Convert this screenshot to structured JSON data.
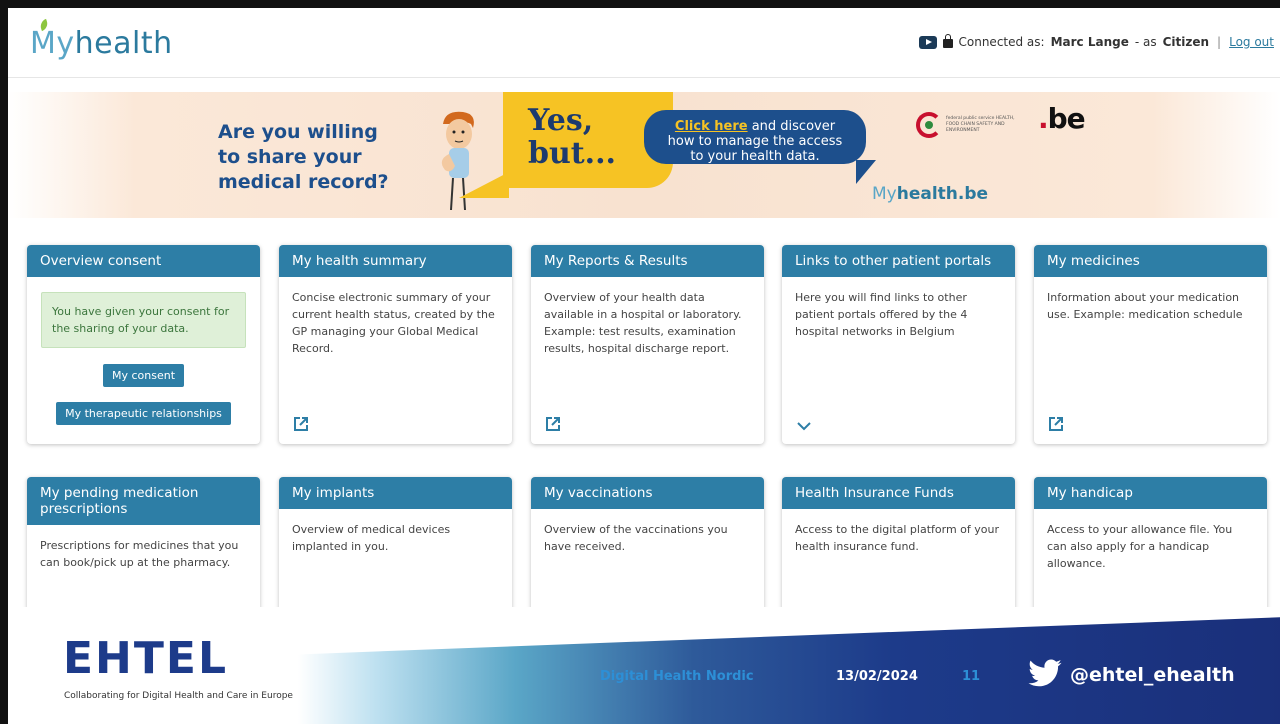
{
  "header": {
    "logo_my": "My",
    "logo_health": "health",
    "connected_prefix": "Connected as:",
    "user_name": "Marc Lange",
    "role_prefix": "- as",
    "role": "Citizen",
    "separator": "|",
    "logout": "Log out"
  },
  "banner": {
    "question_line1": "Are you willing",
    "question_line2": "to share your",
    "question_line3": "medical record?",
    "yes_line1": "Yes,",
    "yes_line2": "but...",
    "click_link": "Click here",
    "click_rest1": " and discover",
    "click_line2": "how to manage the access",
    "click_line3": "to your health data.",
    "fps_text": "federal public service HEALTH, FOOD CHAIN SAFETY AND ENVIRONMENT",
    "be_logo": ".be",
    "site_my": "My",
    "site_rest": "health.be"
  },
  "tiles": {
    "consent": {
      "title": "Overview consent",
      "message": "You have given your consent for the sharing of your data.",
      "btn_consent": "My consent",
      "btn_therapeutic": "My therapeutic relationships"
    },
    "summary": {
      "title": "My health summary",
      "body": "Concise electronic summary of your current health status, created by the GP managing your Global Medical Record."
    },
    "reports": {
      "title": "My Reports & Results",
      "body": "Overview of your health data available in a hospital or laboratory. Example: test results, examination results, hospital discharge report."
    },
    "links": {
      "title": "Links to other patient portals",
      "body": "Here you will find links to other patient portals offered by the 4 hospital networks in Belgium"
    },
    "medicines": {
      "title": "My medicines",
      "body": "Information about your medication use. Example: medication schedule"
    },
    "pending": {
      "title": "My pending medication prescriptions",
      "body": "Prescriptions for medicines that you can book/pick up at the pharmacy."
    },
    "implants": {
      "title": "My implants",
      "body": "Overview of medical devices implanted in you."
    },
    "vaccinations": {
      "title": "My vaccinations",
      "body": "Overview of the vaccinations you have received."
    },
    "insurance": {
      "title": "Health Insurance Funds",
      "body": "Access to the digital platform of your health insurance fund."
    },
    "handicap": {
      "title": "My handicap",
      "body": "Access to your allowance file. You can also apply for a handicap allowance."
    }
  },
  "footer": {
    "ehtel_logo": "EHTEL",
    "ehtel_tagline": "Collaborating for Digital Health and Care in Europe",
    "event": "Digital Health Nordic",
    "date": "13/02/2024",
    "page": "11",
    "handle": "@ehtel_ehealth"
  },
  "colors": {
    "tile_header": "#2d7ea6",
    "consent_bg": "#dff0d8",
    "consent_text": "#3c763d",
    "banner_yellow": "#f6c324",
    "banner_blue": "#1d4f8c",
    "footer_blue": "#1d3b8a"
  },
  "icons": {
    "external_link": "external-link-icon",
    "chevron": "chevron-down-icon",
    "youtube": "youtube-icon",
    "lock": "lock-icon",
    "twitter": "twitter-bird-icon"
  }
}
